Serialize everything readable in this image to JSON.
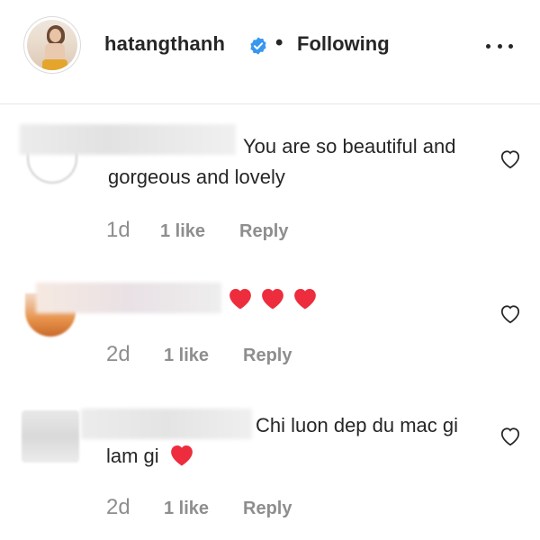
{
  "header": {
    "username": "hatangthanh",
    "separator": "•",
    "follow_status": "Following",
    "verified_icon": "verified-badge-icon",
    "verified_color": "#3897f0",
    "more_icon": "more-options-icon"
  },
  "comments": [
    {
      "text": "You are so beautiful and gorgeous and lovely",
      "emoji": [],
      "time": "1d",
      "likes": "1 like",
      "reply": "Reply"
    },
    {
      "text": "",
      "emoji": [
        "heart",
        "heart",
        "heart"
      ],
      "time": "2d",
      "likes": "1 like",
      "reply": "Reply"
    },
    {
      "text": "Chi luon dep du mac gi lam gi",
      "emoji": [
        "heart"
      ],
      "time": "2d",
      "likes": "1 like",
      "reply": "Reply"
    }
  ],
  "colors": {
    "text": "#262626",
    "muted": "#8e8e8e",
    "heart": "#ed2d3d",
    "divider": "#e6e6e6"
  }
}
